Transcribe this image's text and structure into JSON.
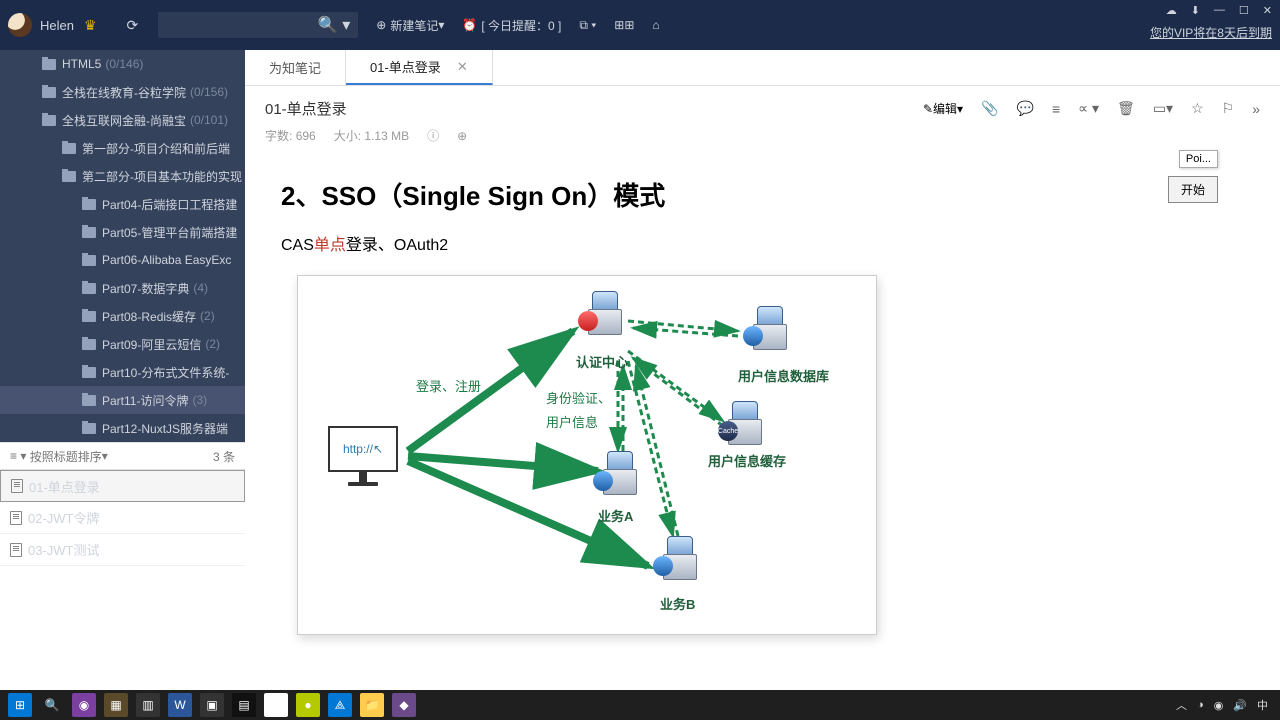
{
  "titlebar": {
    "username": "Helen",
    "new_note": "新建笔记",
    "reminder": "[ 今日提醒：0 ]",
    "vip_note": "您的VIP将在8天后到期"
  },
  "tree": {
    "items": [
      {
        "label": "HTML5",
        "count": "(0/146)",
        "level": "l1"
      },
      {
        "label": "全栈在线教育-谷粒学院",
        "count": "(0/156)",
        "level": "l1"
      },
      {
        "label": "全栈互联网金融-尚融宝",
        "count": "(0/101)",
        "level": "l1"
      },
      {
        "label": "第一部分-项目介绍和前后端",
        "count": "",
        "level": "l2"
      },
      {
        "label": "第二部分-项目基本功能的实现",
        "count": "",
        "level": "l2"
      },
      {
        "label": "Part04-后端接口工程搭建",
        "count": "",
        "level": "l3"
      },
      {
        "label": "Part05-管理平台前端搭建",
        "count": "",
        "level": "l3"
      },
      {
        "label": "Part06-Alibaba EasyExc",
        "count": "",
        "level": "l3"
      },
      {
        "label": "Part07-数据字典",
        "count": "(4)",
        "level": "l3"
      },
      {
        "label": "Part08-Redis缓存",
        "count": "(2)",
        "level": "l3"
      },
      {
        "label": "Part09-阿里云短信",
        "count": "(2)",
        "level": "l3"
      },
      {
        "label": "Part10-分布式文件系统-",
        "count": "",
        "level": "l3"
      },
      {
        "label": "Part11-访问令牌",
        "count": "(3)",
        "level": "l3",
        "sel": true
      },
      {
        "label": "Part12-NuxtJS服务器端",
        "count": "",
        "level": "l3"
      }
    ]
  },
  "sort": {
    "label": "按照标题排序",
    "count": "3 条"
  },
  "notes": {
    "items": [
      {
        "label": "01-单点登录",
        "sel": true
      },
      {
        "label": "02-JWT令牌"
      },
      {
        "label": "03-JWT测试"
      }
    ]
  },
  "tabs": {
    "items": [
      {
        "label": "为知笔记"
      },
      {
        "label": "01-单点登录",
        "active": true
      }
    ]
  },
  "doc": {
    "title": "01-单点登录",
    "word_label": "字数:",
    "word_count": "696",
    "size_label": "大小:",
    "size": "1.13 MB",
    "edit": "编辑",
    "h2": "2、SSO（Single Sign On）模式",
    "p_pre": "CAS",
    "p_hl": "单点",
    "p_post": "登录、OAuth2"
  },
  "diagram": {
    "browser_url": "http://",
    "auth_center": "认证中心",
    "user_db": "用户信息数据库",
    "user_cache": "用户信息缓存",
    "cache_label": "Cache",
    "service_a": "业务A",
    "service_b": "业务B",
    "login_register": "登录、注册",
    "identity": "身份验证、",
    "user_info": "用户信息"
  },
  "popup": {
    "tooltip": "Poi...",
    "start": "开始"
  },
  "tray": {
    "ime": "中"
  }
}
